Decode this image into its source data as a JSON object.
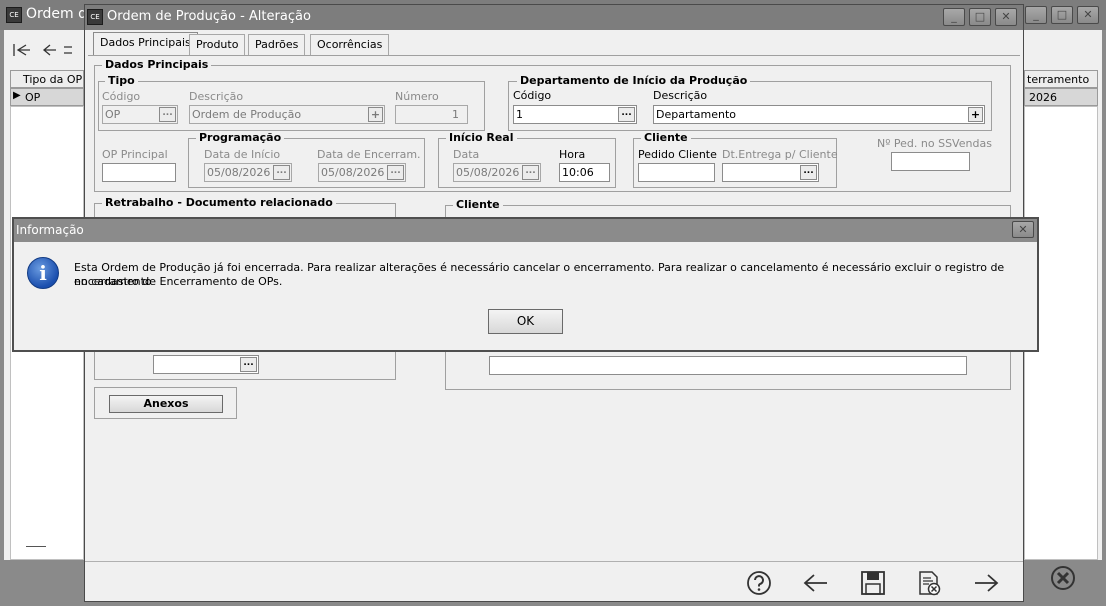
{
  "bg_window": {
    "title": "Ordem de",
    "app_icon_text": "CE",
    "grid_headers": [
      "Tipo da OP",
      "",
      "terramento"
    ],
    "grid_row": [
      "OP",
      "",
      "2026"
    ],
    "controls": [
      "_",
      "□",
      "✕"
    ]
  },
  "main_window": {
    "title": "Ordem de Produção - Alteração",
    "app_icon_text": "CE",
    "tabs": [
      "Dados Principais",
      "Produto",
      "Padrões",
      "Ocorrências"
    ],
    "dados_principais": {
      "legend": "Dados Principais",
      "tipo": {
        "legend": "Tipo",
        "codigo_label": "Código",
        "codigo_value": "OP",
        "descricao_label": "Descrição",
        "descricao_value": "Ordem de Produção",
        "numero_label": "Número",
        "numero_value": "1"
      },
      "departamento": {
        "legend": "Departamento de Início da Produção",
        "codigo_label": "Código",
        "codigo_value": "1",
        "descricao_label": "Descrição",
        "descricao_value": "Departamento"
      },
      "op_principal_label": "OP Principal",
      "op_principal_value": "",
      "programacao": {
        "legend": "Programação",
        "data_inicio_label": "Data de Início",
        "data_inicio_value": "05/08/2026",
        "data_encerram_label": "Data de Encerram.",
        "data_encerram_value": "05/08/2026"
      },
      "inicio_real": {
        "legend": "Início Real",
        "data_label": "Data",
        "data_value": "05/08/2026",
        "hora_label": "Hora",
        "hora_value": "10:06"
      },
      "cliente": {
        "legend": "Cliente",
        "pedido_label": "Pedido Cliente",
        "pedido_value": "",
        "dt_entrega_label": "Dt.Entrega p/ Cliente",
        "dt_entrega_value": ""
      },
      "nped_label": "Nº Ped. no SSVendas",
      "nped_value": "",
      "retrabalho_legend": "Retrabalho - Documento relacionado",
      "cliente2_legend": "Cliente",
      "anexos_label": "Anexos"
    }
  },
  "dialog": {
    "title": "Informação",
    "message_line1": "Esta Ordem de Produção já foi encerrada. Para realizar alterações é necessário cancelar o encerramento. Para realizar o cancelamento é necessário excluir o registro de encerramento",
    "message_line2": "no cadastro de Encerramento de OPs.",
    "ok_label": "OK",
    "close_glyph": "✕",
    "info_glyph": "i"
  },
  "toolbar_icons": [
    "help-icon",
    "back-arrow-icon",
    "save-icon",
    "delete-document-icon",
    "forward-arrow-icon",
    "close-circle-icon"
  ],
  "ellipsis": "...",
  "plus": "+"
}
